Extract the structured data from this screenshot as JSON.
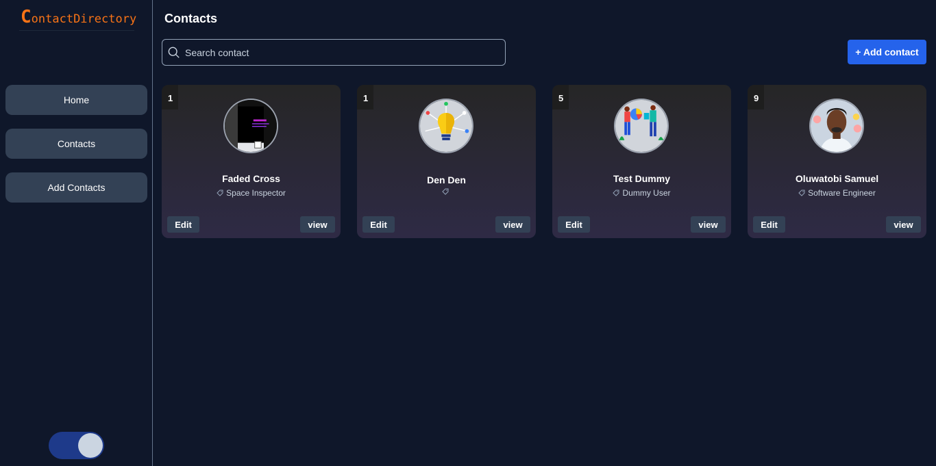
{
  "app": {
    "logo_first": "C",
    "logo_rest": "ontactDirectory"
  },
  "sidebar": {
    "items": [
      {
        "label": "Home"
      },
      {
        "label": "Contacts"
      },
      {
        "label": "Add Contacts"
      }
    ],
    "theme_toggle_on": true
  },
  "main": {
    "title": "Contacts",
    "search_placeholder": "Search contact",
    "add_button": "+ Add contact"
  },
  "contacts": [
    {
      "number": "1",
      "name": "Faded Cross",
      "role": "Space Inspector",
      "avatar_icon": "dark-screenshot-avatar"
    },
    {
      "number": "1",
      "name": "Den Den",
      "role": "",
      "avatar_icon": "lightbulb-avatar"
    },
    {
      "number": "5",
      "name": "Test Dummy",
      "role": "Dummy User",
      "avatar_icon": "people-illustration-avatar"
    },
    {
      "number": "9",
      "name": "Oluwatobi Samuel",
      "role": "Software Engineer",
      "avatar_icon": "person-photo-avatar"
    }
  ],
  "card_buttons": {
    "edit": "Edit",
    "view": "view"
  },
  "colors": {
    "accent": "#2563eb",
    "logo": "#f97316",
    "background": "#0f172a",
    "nav_button": "#334155"
  }
}
